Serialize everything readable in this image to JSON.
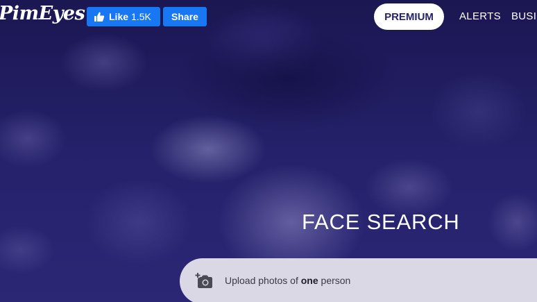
{
  "brand": {
    "logo_text": "PimEyes"
  },
  "facebook": {
    "like_label": "Like",
    "like_count": "1.5K",
    "share_label": "Share",
    "color": "#1877f2"
  },
  "nav": {
    "premium_label": "PREMIUM",
    "alerts_label": "ALERTS",
    "business_label": "BUSIN"
  },
  "hero": {
    "title": "FACE SEARCH"
  },
  "upload": {
    "text_before": "Upload photos of ",
    "text_bold": "one",
    "text_after": " person",
    "icon": "add-photo-camera-icon"
  },
  "colors": {
    "background": "#1a1650",
    "premium_text": "#25226a",
    "upload_bar": "#d9d8e4"
  }
}
